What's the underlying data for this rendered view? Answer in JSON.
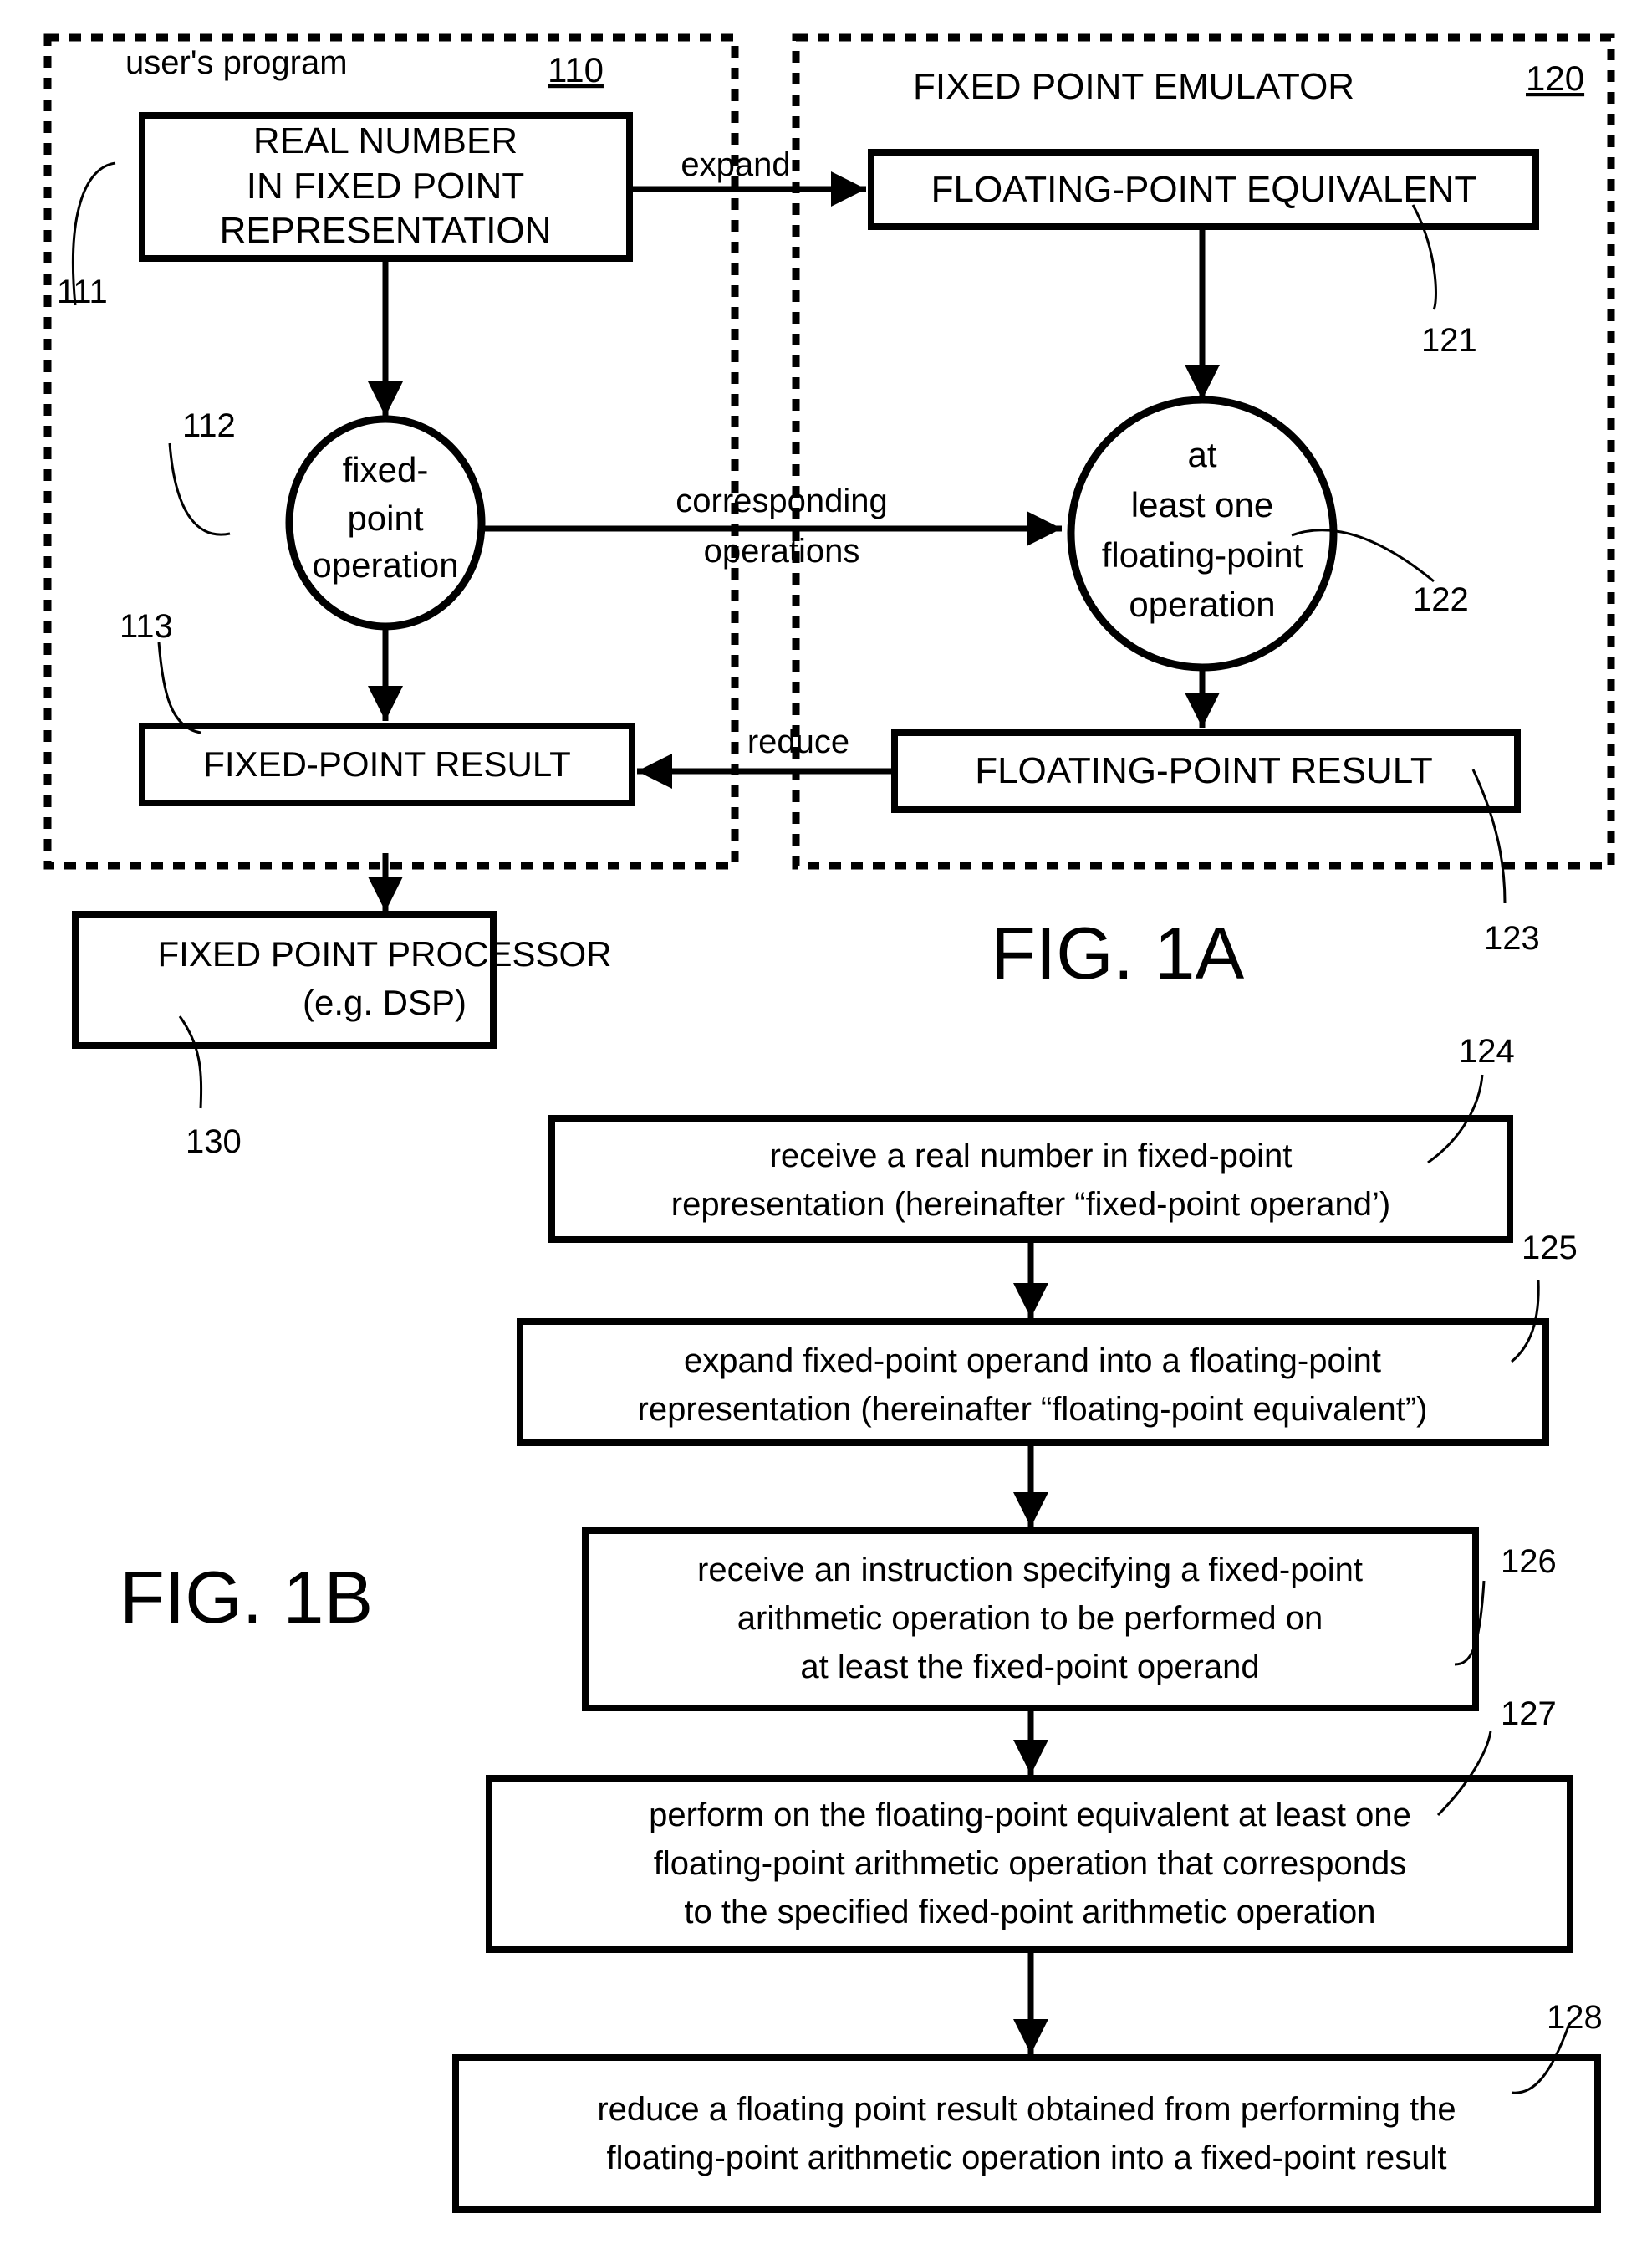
{
  "fig1a": {
    "title": "FIG. 1A",
    "users_program": {
      "label": "user's program",
      "ref": "110",
      "real_number_box": {
        "lines": [
          "REAL NUMBER",
          "IN FIXED POINT",
          "REPRESENTATION"
        ],
        "ref": "111"
      },
      "fixed_op_circle": {
        "lines": [
          "fixed-",
          "point",
          "operation"
        ],
        "ref": "112"
      },
      "fixed_result_box": {
        "label": "FIXED-POINT RESULT",
        "ref": "113"
      }
    },
    "emulator": {
      "label": "FIXED POINT EMULATOR",
      "ref": "120",
      "float_equiv_box": {
        "label": "FLOATING-POINT EQUIVALENT",
        "ref": "121"
      },
      "float_op_circle": {
        "lines": [
          "at",
          "least one",
          "floating-point",
          "operation"
        ],
        "ref": "122"
      },
      "float_result_box": {
        "label": "FLOATING-POINT RESULT",
        "ref": "123"
      }
    },
    "processor": {
      "lines": [
        "FIXED POINT PROCESSOR",
        "(e.g. DSP)"
      ],
      "ref": "130"
    },
    "arrows": {
      "expand": "expand",
      "corresponding": [
        "corresponding",
        "operations"
      ],
      "reduce": "reduce"
    }
  },
  "fig1b": {
    "title": "FIG. 1B",
    "steps": [
      {
        "ref": "124",
        "lines": [
          "receive a real number in fixed-point",
          "representation (hereinafter “fixed-point operand’)"
        ]
      },
      {
        "ref": "125",
        "lines": [
          "expand fixed-point operand into a floating-point",
          "representation (hereinafter “floating-point equivalent”)"
        ]
      },
      {
        "ref": "126",
        "lines": [
          "receive an instruction specifying a fixed-point",
          "arithmetic  operation to be performed on",
          "at least the fixed-point operand"
        ]
      },
      {
        "ref": "127",
        "lines": [
          "perform on the floating-point equivalent at least one",
          "floating-point arithmetic operation that corresponds",
          "to the specified fixed-point arithmetic operation"
        ]
      },
      {
        "ref": "128",
        "lines": [
          "reduce a floating point result obtained from performing the",
          "floating-point arithmetic operation into a fixed-point result"
        ]
      }
    ]
  }
}
